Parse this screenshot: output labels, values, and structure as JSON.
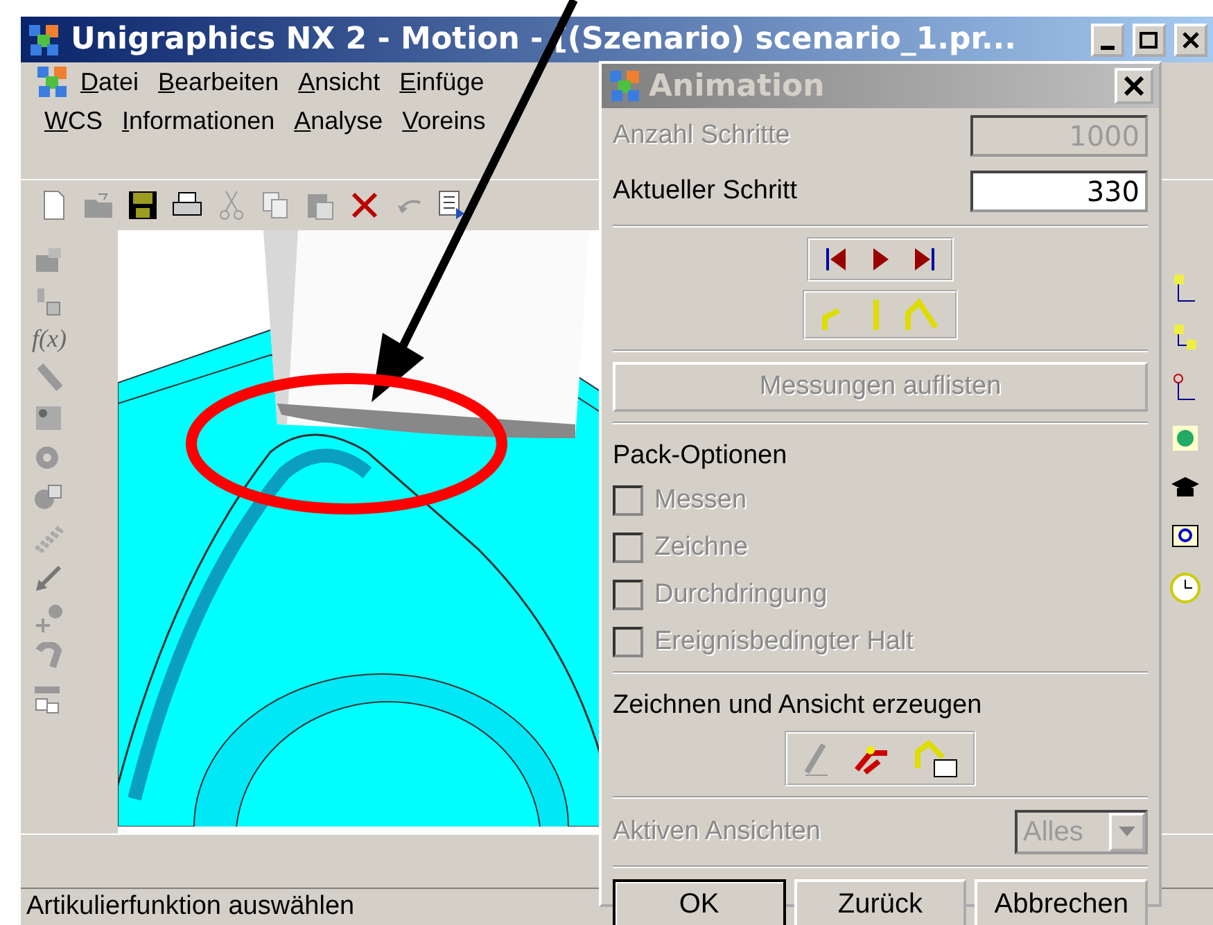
{
  "window": {
    "title": "Unigraphics NX 2 - Motion - [(Szenario) scenario_1.pr..."
  },
  "menu": [
    [
      "Datei",
      "Bearbeiten",
      "Ansicht",
      "Einfüge"
    ],
    [
      "WCS",
      "Informationen",
      "Analyse",
      "Voreins"
    ]
  ],
  "left_toolbar": {
    "formula_label": "f(x)"
  },
  "status_bar": {
    "text": "Artikulierfunktion auswählen"
  },
  "dialog": {
    "title": "Animation",
    "fields": [
      {
        "label": "Anzahl Schritte",
        "value": "1000",
        "disabled": true
      },
      {
        "label": "Aktueller Schritt",
        "value": "330",
        "disabled": false
      }
    ],
    "list_button": {
      "label": "Messungen auflisten",
      "disabled": true
    },
    "pack_options": {
      "heading": "Pack-Optionen",
      "options": [
        {
          "label": "Messen",
          "checked": false,
          "disabled": true
        },
        {
          "label": "Zeichne",
          "checked": false,
          "disabled": true
        },
        {
          "label": "Durchdringung",
          "checked": false,
          "disabled": true
        },
        {
          "label": "Ereignisbedingter Halt",
          "checked": false,
          "disabled": true
        }
      ]
    },
    "draw_heading": "Zeichnen und Ansicht erzeugen",
    "active_views": {
      "label": "Aktiven Ansichten",
      "value": "Alles",
      "disabled": true
    },
    "buttons": [
      {
        "label": "OK",
        "default": true
      },
      {
        "label": "Zurück",
        "default": false
      },
      {
        "label": "Abbrechen",
        "default": false
      }
    ]
  }
}
